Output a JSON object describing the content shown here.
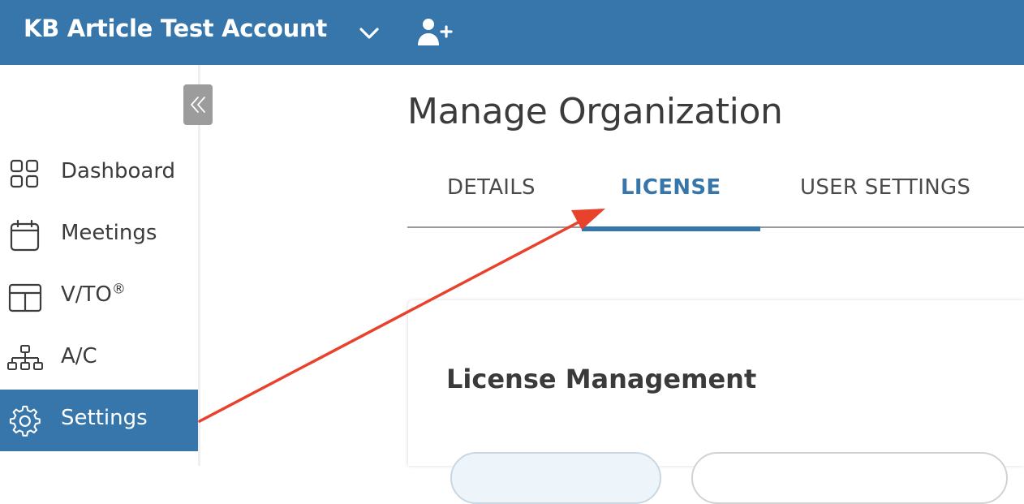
{
  "header": {
    "org_name": "KB Article Test Account",
    "dropdown_icon": "chevron-down-icon",
    "add_user_icon": "user-plus-icon",
    "background_color": "#3776ab"
  },
  "sidebar": {
    "collapse_icon": "double-chevron-left-icon",
    "items": [
      {
        "label": "Dashboard",
        "icon": "grid-icon",
        "active": false
      },
      {
        "label": "Meetings",
        "icon": "calendar-icon",
        "active": false
      },
      {
        "label": "V/TO",
        "superscript": "®",
        "icon": "layout-icon",
        "active": false
      },
      {
        "label": "A/C",
        "icon": "org-chart-icon",
        "active": false
      },
      {
        "label": "Settings",
        "icon": "gear-icon",
        "active": true
      }
    ]
  },
  "main": {
    "title": "Manage Organization",
    "tabs": [
      {
        "label": "DETAILS",
        "active": false
      },
      {
        "label": "LICENSE",
        "active": true
      },
      {
        "label": "USER SETTINGS",
        "active": false
      }
    ],
    "card": {
      "title": "License Management"
    }
  },
  "colors": {
    "accent": "#3776ab",
    "annotation_arrow": "#e8412c",
    "collapse_button": "#9c9c9c"
  }
}
